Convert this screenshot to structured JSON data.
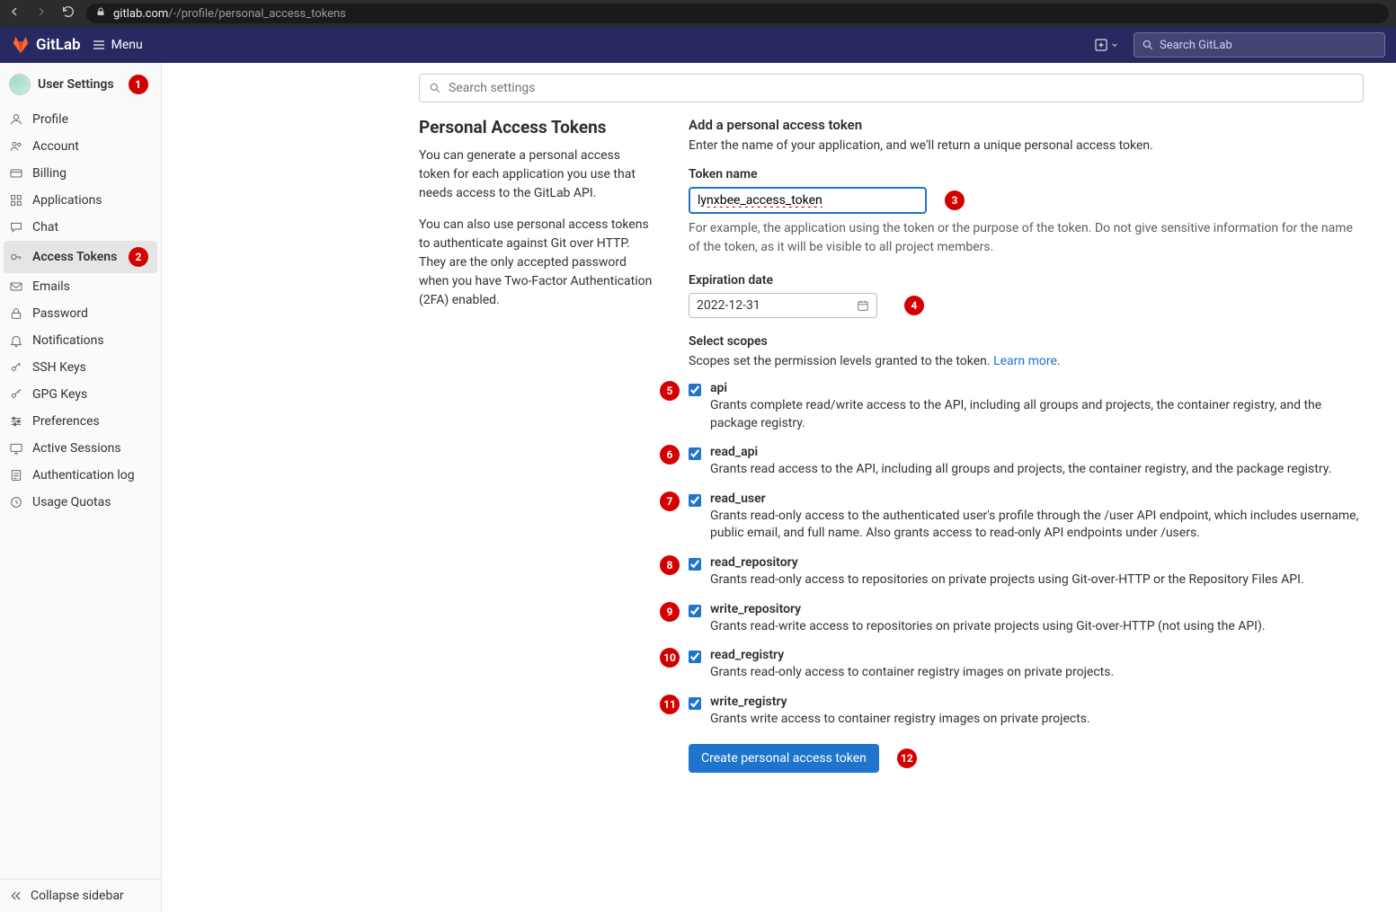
{
  "browser": {
    "url_domain": "gitlab.com",
    "url_path": "/-/profile/personal_access_tokens"
  },
  "topnav": {
    "brand": "GitLab",
    "menu": "Menu",
    "search_placeholder": "Search GitLab"
  },
  "sidebar": {
    "header": "User Settings",
    "items": [
      {
        "label": "Profile",
        "icon": "profile-icon"
      },
      {
        "label": "Account",
        "icon": "account-icon"
      },
      {
        "label": "Billing",
        "icon": "billing-icon"
      },
      {
        "label": "Applications",
        "icon": "applications-icon"
      },
      {
        "label": "Chat",
        "icon": "chat-icon"
      },
      {
        "label": "Access Tokens",
        "icon": "access-tokens-icon",
        "active": true
      },
      {
        "label": "Emails",
        "icon": "emails-icon"
      },
      {
        "label": "Password",
        "icon": "password-icon"
      },
      {
        "label": "Notifications",
        "icon": "notifications-icon"
      },
      {
        "label": "SSH Keys",
        "icon": "ssh-keys-icon"
      },
      {
        "label": "GPG Keys",
        "icon": "gpg-keys-icon"
      },
      {
        "label": "Preferences",
        "icon": "preferences-icon"
      },
      {
        "label": "Active Sessions",
        "icon": "active-sessions-icon"
      },
      {
        "label": "Authentication log",
        "icon": "auth-log-icon"
      },
      {
        "label": "Usage Quotas",
        "icon": "usage-quotas-icon"
      }
    ],
    "collapse": "Collapse sidebar"
  },
  "content": {
    "search_placeholder": "Search settings",
    "title": "Personal Access Tokens",
    "desc1": "You can generate a personal access token for each application you use that needs access to the GitLab API.",
    "desc2": "You can also use personal access tokens to authenticate against Git over HTTP. They are the only accepted password when you have Two-Factor Authentication (2FA) enabled.",
    "add_heading": "Add a personal access token",
    "add_sub": "Enter the name of your application, and we'll return a unique personal access token.",
    "token_name_label": "Token name",
    "token_name_value": "lynxbee_access_token",
    "token_name_hint": "For example, the application using the token or the purpose of the token. Do not give sensitive information for the name of the token, as it will be visible to all project members.",
    "expiration_label": "Expiration date",
    "expiration_value": "2022-12-31",
    "scopes_label": "Select scopes",
    "scopes_sub": "Scopes set the permission levels granted to the token. ",
    "scopes_learn_more": "Learn more",
    "scopes": [
      {
        "name": "api",
        "desc": "Grants complete read/write access to the API, including all groups and projects, the container registry, and the package registry.",
        "checked": true
      },
      {
        "name": "read_api",
        "desc": "Grants read access to the API, including all groups and projects, the container registry, and the package registry.",
        "checked": true
      },
      {
        "name": "read_user",
        "desc": "Grants read-only access to the authenticated user's profile through the /user API endpoint, which includes username, public email, and full name. Also grants access to read-only API endpoints under /users.",
        "checked": true
      },
      {
        "name": "read_repository",
        "desc": "Grants read-only access to repositories on private projects using Git-over-HTTP or the Repository Files API.",
        "checked": true
      },
      {
        "name": "write_repository",
        "desc": "Grants read-write access to repositories on private projects using Git-over-HTTP (not using the API).",
        "checked": true
      },
      {
        "name": "read_registry",
        "desc": "Grants read-only access to container registry images on private projects.",
        "checked": true
      },
      {
        "name": "write_registry",
        "desc": "Grants write access to container registry images on private projects.",
        "checked": true
      }
    ],
    "submit": "Create personal access token"
  },
  "annotations": {
    "1": "1",
    "2": "2",
    "3": "3",
    "4": "4",
    "5": "5",
    "6": "6",
    "7": "7",
    "8": "8",
    "9": "9",
    "10": "10",
    "11": "11",
    "12": "12"
  }
}
